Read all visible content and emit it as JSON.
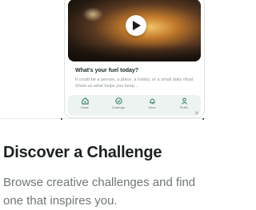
{
  "card": {
    "title": "What's your fuel today?",
    "description": "It could be a person, a place, a hobby, or a small daily ritual. Show us what helps you keep..."
  },
  "tabs": [
    {
      "label": "Home",
      "icon": "home-icon"
    },
    {
      "label": "Challenge",
      "icon": "check-circle-icon"
    },
    {
      "label": "Inbox",
      "icon": "bell-icon"
    },
    {
      "label": "Profile",
      "icon": "person-icon"
    }
  ],
  "close_glyph": "✕",
  "feature": {
    "title": "Discover a Challenge",
    "description": "Browse creative challenges and find one that inspires you."
  },
  "colors": {
    "tab_icon": "#2f7d5b",
    "tabbar_bg": "#edf3f1",
    "heading": "#1b2220",
    "body_text": "#6f7875"
  }
}
